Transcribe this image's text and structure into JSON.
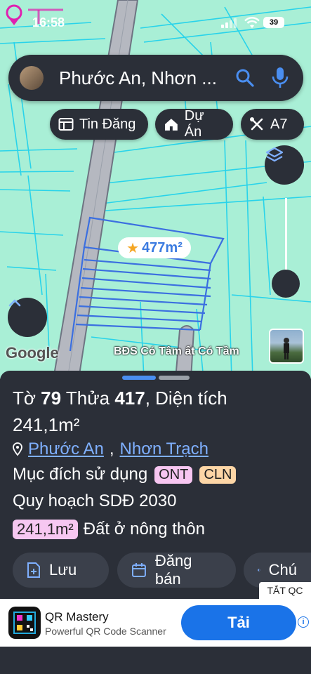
{
  "status_bar": {
    "time": "16:58",
    "battery": "39"
  },
  "search": {
    "query": "Phước An, Nhơn ..."
  },
  "chips": [
    {
      "label": "Tin Đăng",
      "icon": "newspaper-icon"
    },
    {
      "label": "Dự Án",
      "icon": "house-icon"
    },
    {
      "label": "A7",
      "icon": "tools-icon"
    }
  ],
  "map": {
    "plot_area_label": "477m²",
    "google_logo": "Google",
    "watermark": "BĐS Có Tâm ất Có Tầm",
    "zoom_level": 0.8
  },
  "parcel": {
    "sheet_prefix": "Tờ",
    "sheet_no": "79",
    "lot_prefix": "Thửa",
    "lot_no": "417",
    "area_prefix": ", Diện tích",
    "area": "241,1m²",
    "ward": "Phước An",
    "district": "Nhơn Trạch",
    "purpose_label": "Mục đích sử dụng",
    "purpose_codes": [
      {
        "code": "ONT",
        "color": "#f7c6f1"
      },
      {
        "code": "CLN",
        "color": "#fdd6a6"
      }
    ],
    "plan_label": "Quy hoạch SDĐ 2030",
    "plan_area": "241,1m²",
    "plan_type": "Đất ở nông thôn"
  },
  "actions": [
    {
      "label": "Lưu",
      "icon": "add-file-icon"
    },
    {
      "label": "Đăng bán",
      "icon": "calendar-icon"
    },
    {
      "label": "Chú",
      "icon": "contrast-icon"
    }
  ],
  "ad": {
    "close_label": "TẮT QC",
    "app_name": "QR Mastery",
    "app_subtitle": "Powerful QR Code Scanner",
    "cta": "Tải",
    "info": "i"
  },
  "colors": {
    "map_bg": "#a9efd6",
    "parcel_line": "#3b6fe0",
    "panel": "#2b2f38",
    "accent": "#1a73e8"
  }
}
